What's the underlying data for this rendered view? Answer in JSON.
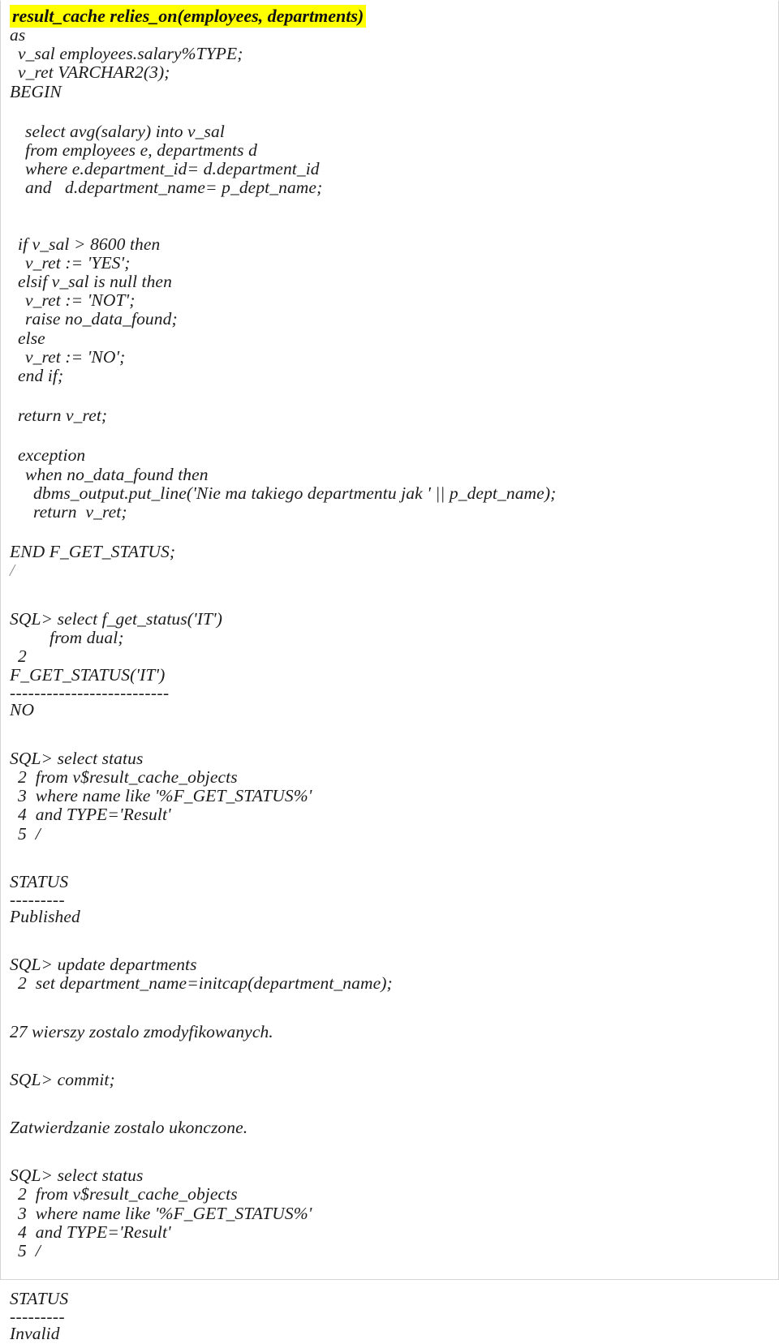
{
  "document": {
    "kind": "plsql-listing",
    "highlight_color": "#ffff00",
    "page_background": "#ffffff",
    "text_color": "#1b1b1b",
    "header_line": "result_cache relies_on(employees, departments)",
    "lines": {
      "l_as": "as",
      "l_vsal": "v_sal employees.salary%TYPE;",
      "l_vret": "v_ret VARCHAR2(3);",
      "l_begin": "BEGIN",
      "l_select": "select avg(salary) into v_sal",
      "l_from": "from employees e, departments d",
      "l_where": "where e.department_id= d.department_id",
      "l_and": "and   d.department_name= p_dept_name;",
      "l_if": "if v_sal > 8600 then",
      "l_yes": "v_ret := 'YES';",
      "l_elsif": "elsif v_sal is null then",
      "l_not": "v_ret := 'NOT';",
      "l_raise": "raise no_data_found;",
      "l_else": "else",
      "l_no": "v_ret := 'NO';",
      "l_endif": "end if;",
      "l_return1": "return v_ret;",
      "l_exception": "exception",
      "l_when": "when no_data_found then",
      "l_dbms": "dbms_output.put_line('Nie ma takiego departmentu jak ' || p_dept_name);",
      "l_return2": "return  v_ret;",
      "l_endfunc": "END F_GET_STATUS;",
      "l_slash1": "/",
      "l_sql1": "SQL> select f_get_status('IT')",
      "l_sql1_from": "from dual;",
      "l_sql1_num2": "2",
      "l_colhdr1": "F_GET_STATUS('IT')",
      "l_rule_long": "--------------------------",
      "l_val_no": "NO",
      "l_sql2_1": "SQL> select status",
      "l_sql2_2": "2  from v$result_cache_objects",
      "l_sql2_3": "3  where name like '%F_GET_STATUS%'",
      "l_sql2_4": "4  and TYPE='Result'",
      "l_sql2_5": "5  /",
      "l_colhdr_status_1": "STATUS",
      "l_rule_short_1": "---------",
      "l_val_published": "Published",
      "l_sql3_1": "SQL> update departments",
      "l_sql3_2": "2  set department_name=initcap(department_name);",
      "l_msg_rows": "27 wierszy zostalo zmodyfikowanych.",
      "l_sql4": "SQL> commit;",
      "l_msg_commit": "Zatwierdzanie zostalo ukonczone.",
      "l_sql5_1": "SQL> select status",
      "l_sql5_2": "2  from v$result_cache_objects",
      "l_sql5_3": "3  where name like '%F_GET_STATUS%'",
      "l_sql5_4": "4  and TYPE='Result'",
      "l_sql5_5": "5  /",
      "l_colhdr_status_2": "STATUS",
      "l_rule_short_2": "---------",
      "l_val_invalid": "Invalid"
    }
  }
}
